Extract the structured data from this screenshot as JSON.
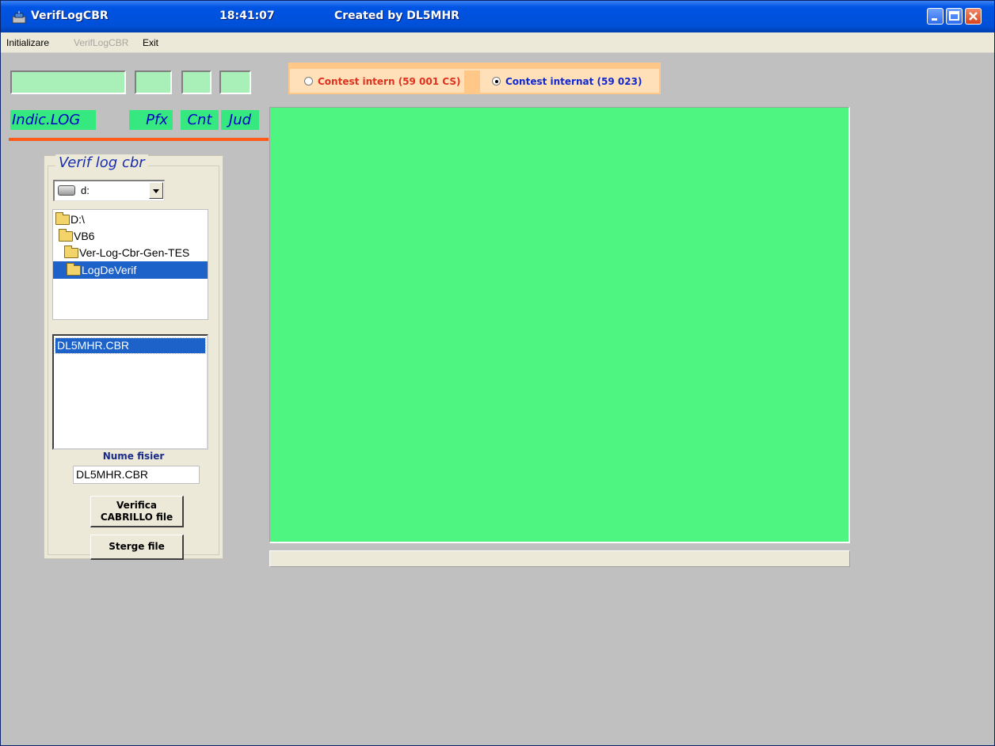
{
  "window": {
    "title": "VerifLogCBR",
    "clock": "18:41:07",
    "credit": "Created by DL5MHR"
  },
  "menu": {
    "items": [
      {
        "label": "Initializare",
        "enabled": true
      },
      {
        "label": "VerifLogCBR",
        "enabled": false
      },
      {
        "label": "Exit",
        "enabled": true
      }
    ]
  },
  "header": {
    "labels": {
      "indic": "Indic.LOG",
      "pfx": "Pfx",
      "cnt": "Cnt",
      "jud": "Jud"
    }
  },
  "contest": {
    "options": [
      {
        "label": "Contest intern  (59 001 CS)",
        "color": "#e0301e",
        "selected": false
      },
      {
        "label": "Contest internat  (59 023)",
        "color": "#1028d0",
        "selected": true
      }
    ]
  },
  "verif": {
    "title": "Verif log cbr",
    "drive": "d:",
    "folders": [
      {
        "label": "D:\\",
        "selected": false
      },
      {
        "label": "VB6",
        "selected": false
      },
      {
        "label": "Ver-Log-Cbr-Gen-TES",
        "selected": false
      },
      {
        "label": "LogDeVerif",
        "selected": true
      }
    ],
    "files": [
      "DL5MHR.CBR"
    ],
    "filename_label": "Nume fisier",
    "filename_value": "DL5MHR.CBR",
    "verify_button": [
      "Verifica",
      "CABRILLO file"
    ],
    "clear_button": "Sterge file"
  },
  "colors": {
    "title_bar": "#0054e3",
    "main_panel": "#4ff581",
    "label_green": "#36e880",
    "input_green": "#a8f0b8",
    "accent_orange": "#ff5a1a",
    "radio_frame": "#ffc888"
  }
}
